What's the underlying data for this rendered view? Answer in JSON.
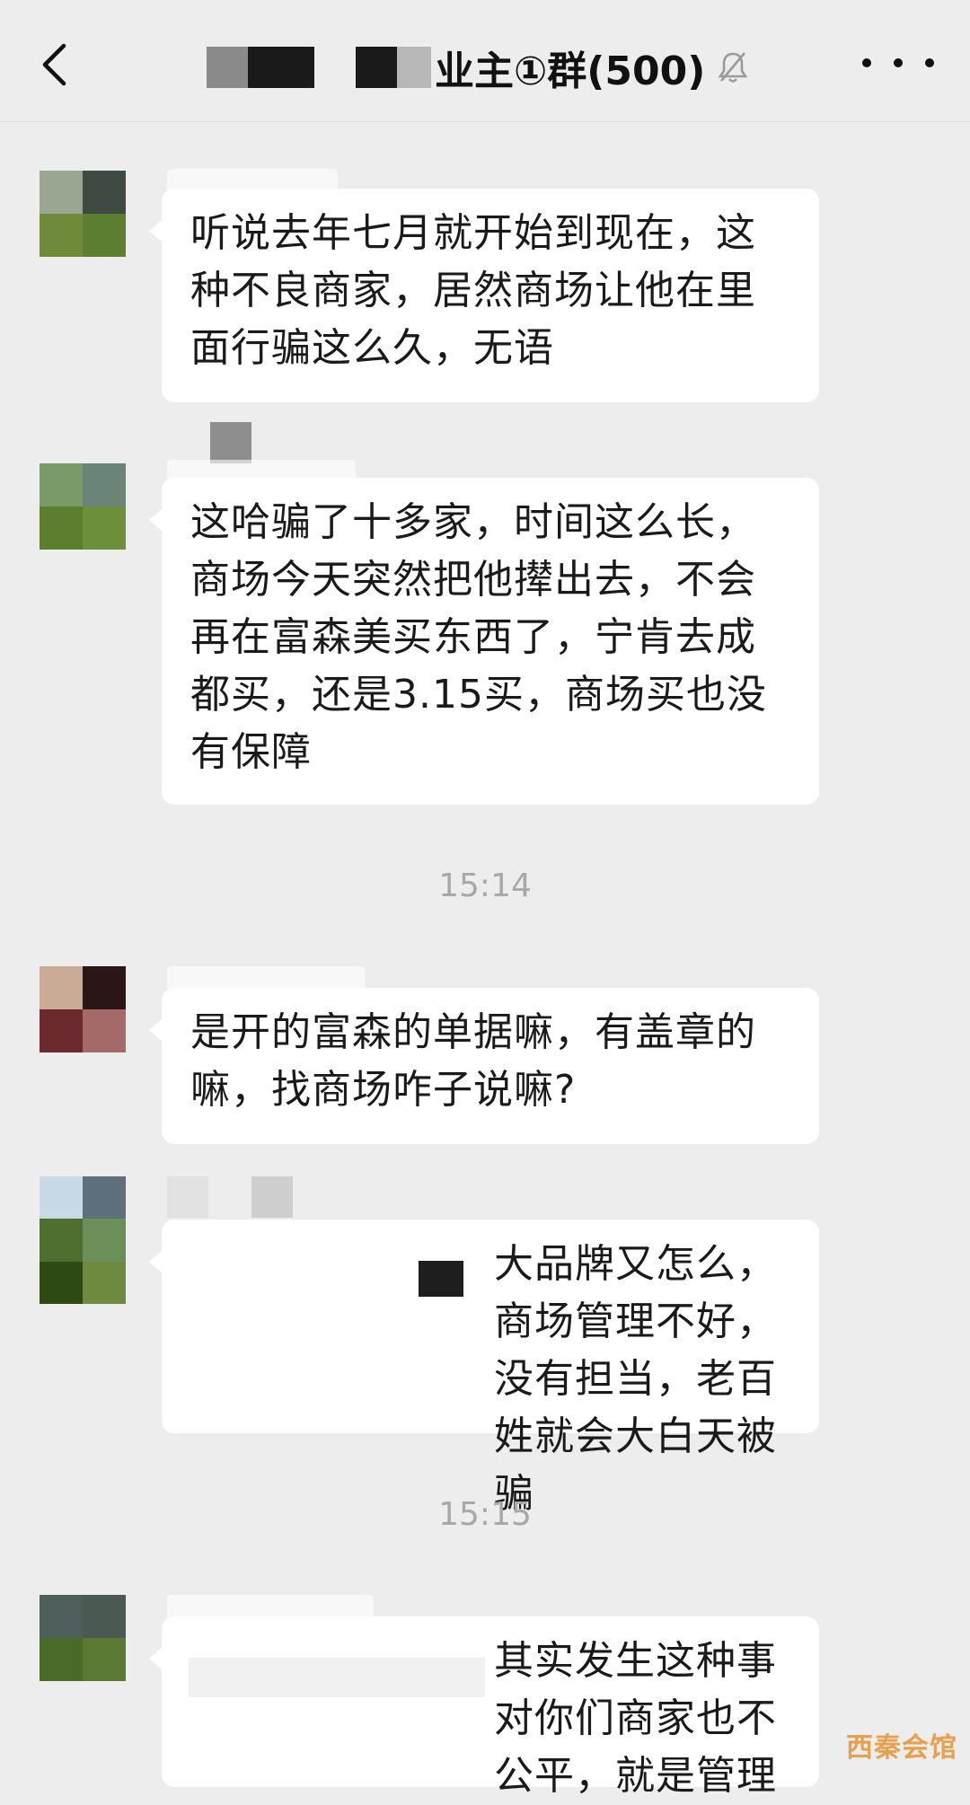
{
  "header": {
    "title": "业主①群(500)",
    "back_icon": "chevron-left-icon",
    "mute_icon": "bell-off-icon",
    "more_icon": "more-icon"
  },
  "messages": [
    {
      "text": "听说去年七月就开始到现在，这种不良商家，居然商场让他在里面行骗这么久，无语"
    },
    {
      "text": "这哈骗了十多家，时间这么长，商场今天突然把他撵出去，不会再在富森美买东西了，宁肯去成都买，还是3.15买，商场买也没有保障"
    },
    {
      "text": "是开的富森的单据嘛，有盖章的嘛，找商场咋子说嘛?"
    },
    {
      "text": "大品牌又怎么，商场管理不好，没有担当，老百姓就会大白天被骗"
    },
    {
      "text": "其实发生这种事对你们商家也不公平，就是管理"
    }
  ],
  "timestamps": [
    "15:14",
    "15:15"
  ],
  "watermark": "西秦会馆",
  "colors": {
    "background": "#ededed",
    "bubble": "#ffffff",
    "timestamp": "#a8a8a8",
    "watermark": "#e7a04e"
  }
}
